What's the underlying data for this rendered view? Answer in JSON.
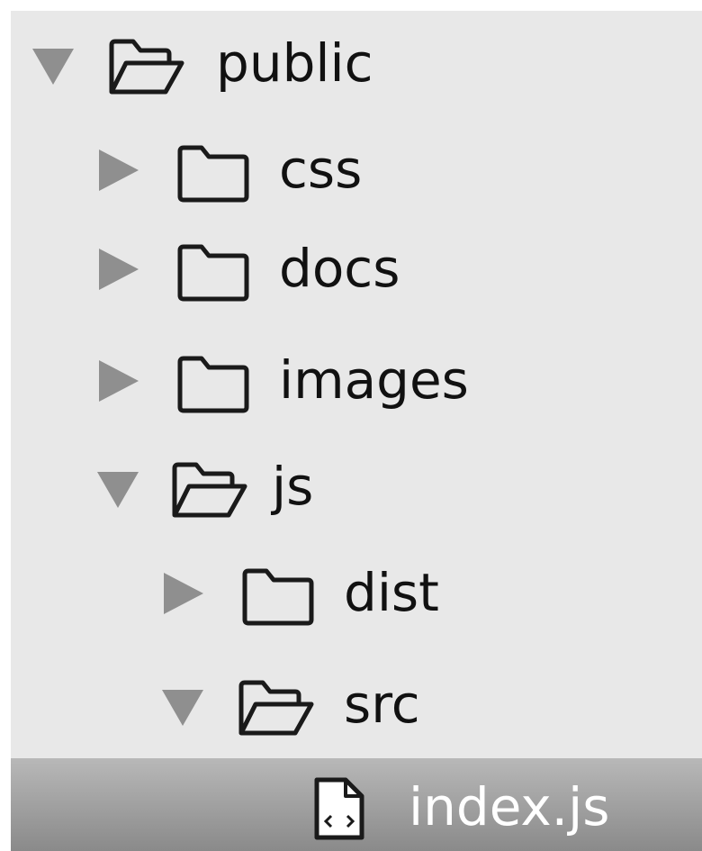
{
  "tree": {
    "items": [
      {
        "label": "public",
        "depth": 0,
        "expanded": true,
        "kind": "folder"
      },
      {
        "label": "css",
        "depth": 1,
        "expanded": false,
        "kind": "folder"
      },
      {
        "label": "docs",
        "depth": 1,
        "expanded": false,
        "kind": "folder"
      },
      {
        "label": "images",
        "depth": 1,
        "expanded": false,
        "kind": "folder"
      },
      {
        "label": "js",
        "depth": 1,
        "expanded": true,
        "kind": "folder"
      },
      {
        "label": "dist",
        "depth": 2,
        "expanded": false,
        "kind": "folder"
      },
      {
        "label": "src",
        "depth": 2,
        "expanded": true,
        "kind": "folder"
      },
      {
        "label": "index.js",
        "depth": 3,
        "selected": true,
        "kind": "file"
      }
    ]
  },
  "icons": {
    "expanded_arrow": "triangle-down-icon",
    "collapsed_arrow": "triangle-right-icon",
    "open_folder": "folder-open-icon",
    "closed_folder": "folder-icon",
    "file": "code-file-icon"
  },
  "colors": {
    "panel_background": "#e8e8e8",
    "arrow": "#8f8f8f",
    "selected_row_top": "#b8b8b8",
    "selected_row_bottom": "#8a8a8a",
    "label_text": "#111111",
    "selected_label_text": "#ffffff"
  }
}
